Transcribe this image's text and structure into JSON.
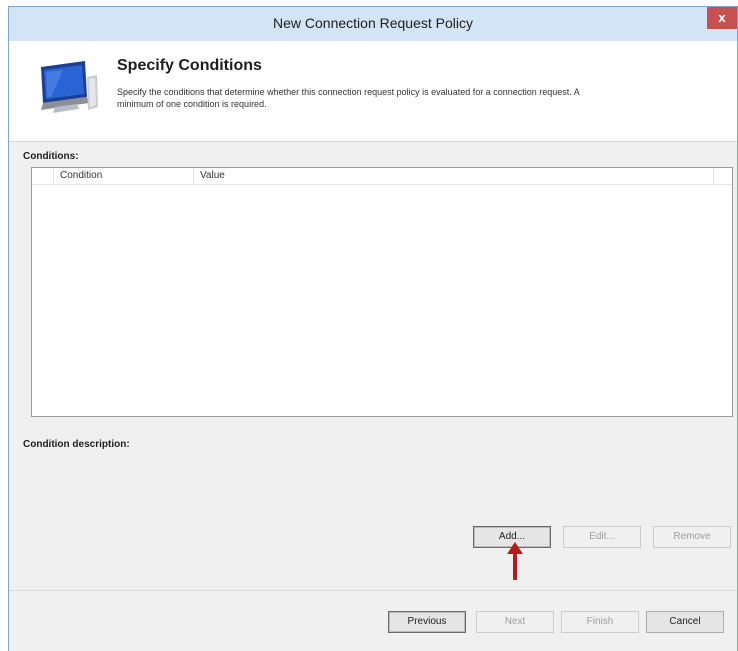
{
  "window": {
    "title": "New Connection Request Policy",
    "close_glyph": "x"
  },
  "header": {
    "title": "Specify Conditions",
    "description_line1": "Specify the conditions that determine whether this connection request policy is evaluated for a connection request. A",
    "description_line2": "minimum of one condition is required.",
    "icon": "computer-monitor-icon"
  },
  "conditions": {
    "label": "Conditions:",
    "columns": [
      "Condition",
      "Value"
    ],
    "rows": []
  },
  "condition_description": {
    "label": "Condition description:"
  },
  "condition_buttons": {
    "add": "Add...",
    "edit": "Edit...",
    "remove": "Remove"
  },
  "footer_buttons": {
    "previous": "Previous",
    "next": "Next",
    "finish": "Finish",
    "cancel": "Cancel"
  },
  "colors": {
    "titlebar": "#d3e4f7",
    "close_button": "#c75050",
    "annotation_arrow": "#b01b1b"
  }
}
